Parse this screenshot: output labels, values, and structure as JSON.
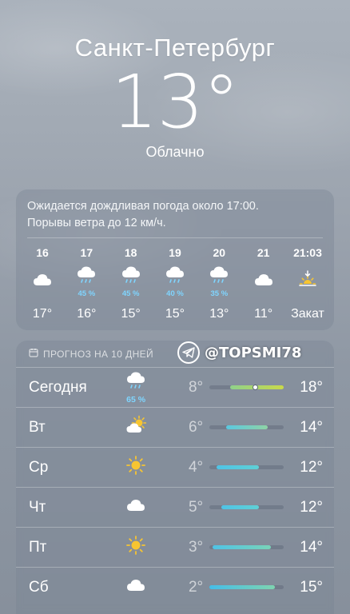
{
  "location": {
    "city": "Санкт-Петербург",
    "temperature": "13°",
    "condition": "Облачно"
  },
  "hourly": {
    "summary_line1": "Ожидается дождливая погода около 17:00.",
    "summary_line2": "Порывы ветра до 12 км/ч.",
    "items": [
      {
        "time": "16",
        "icon": "cloud-icon",
        "pop": "",
        "temp": "17°"
      },
      {
        "time": "17",
        "icon": "cloud-rain-icon",
        "pop": "45 %",
        "temp": "16°"
      },
      {
        "time": "18",
        "icon": "cloud-rain-icon",
        "pop": "45 %",
        "temp": "15°"
      },
      {
        "time": "19",
        "icon": "cloud-rain-icon",
        "pop": "40 %",
        "temp": "15°"
      },
      {
        "time": "20",
        "icon": "cloud-rain-icon",
        "pop": "35 %",
        "temp": "13°"
      },
      {
        "time": "21",
        "icon": "cloud-icon",
        "pop": "",
        "temp": "11°"
      },
      {
        "time": "21:03",
        "icon": "sunset-icon",
        "pop": "",
        "temp": "Закат"
      }
    ]
  },
  "daily": {
    "header": "ПРОГНОЗ НА 10 ДНЕЙ",
    "days": [
      {
        "name": "Сегодня",
        "icon": "cloud-rain-icon",
        "pop": "65 %",
        "low": "8°",
        "high": "18°",
        "bar_start": 0.28,
        "bar_end": 1.0,
        "current": 0.62,
        "colors": [
          "#8fd18b",
          "#c9d94a"
        ]
      },
      {
        "name": "Вт",
        "icon": "sun-cloud-icon",
        "pop": "",
        "low": "6°",
        "high": "14°",
        "bar_start": 0.22,
        "bar_end": 0.78,
        "colors": [
          "#5ac8e0",
          "#8fd3a5"
        ]
      },
      {
        "name": "Ср",
        "icon": "sun-icon",
        "pop": "",
        "low": "4°",
        "high": "12°",
        "bar_start": 0.1,
        "bar_end": 0.66,
        "colors": [
          "#4fc3e6",
          "#5fd0d5"
        ]
      },
      {
        "name": "Чт",
        "icon": "cloud-icon",
        "pop": "",
        "low": "5°",
        "high": "12°",
        "bar_start": 0.16,
        "bar_end": 0.66,
        "colors": [
          "#4fc3e6",
          "#5fd0d5"
        ]
      },
      {
        "name": "Пт",
        "icon": "sun-icon",
        "pop": "",
        "low": "3°",
        "high": "14°",
        "bar_start": 0.04,
        "bar_end": 0.82,
        "colors": [
          "#4fc3e6",
          "#79d3b8"
        ]
      },
      {
        "name": "Сб",
        "icon": "cloud-icon",
        "pop": "",
        "low": "2°",
        "high": "15°",
        "bar_start": 0.0,
        "bar_end": 0.88,
        "colors": [
          "#45bde8",
          "#7ed4b0"
        ]
      }
    ]
  },
  "watermark": {
    "text": "@TOPSMI78"
  }
}
